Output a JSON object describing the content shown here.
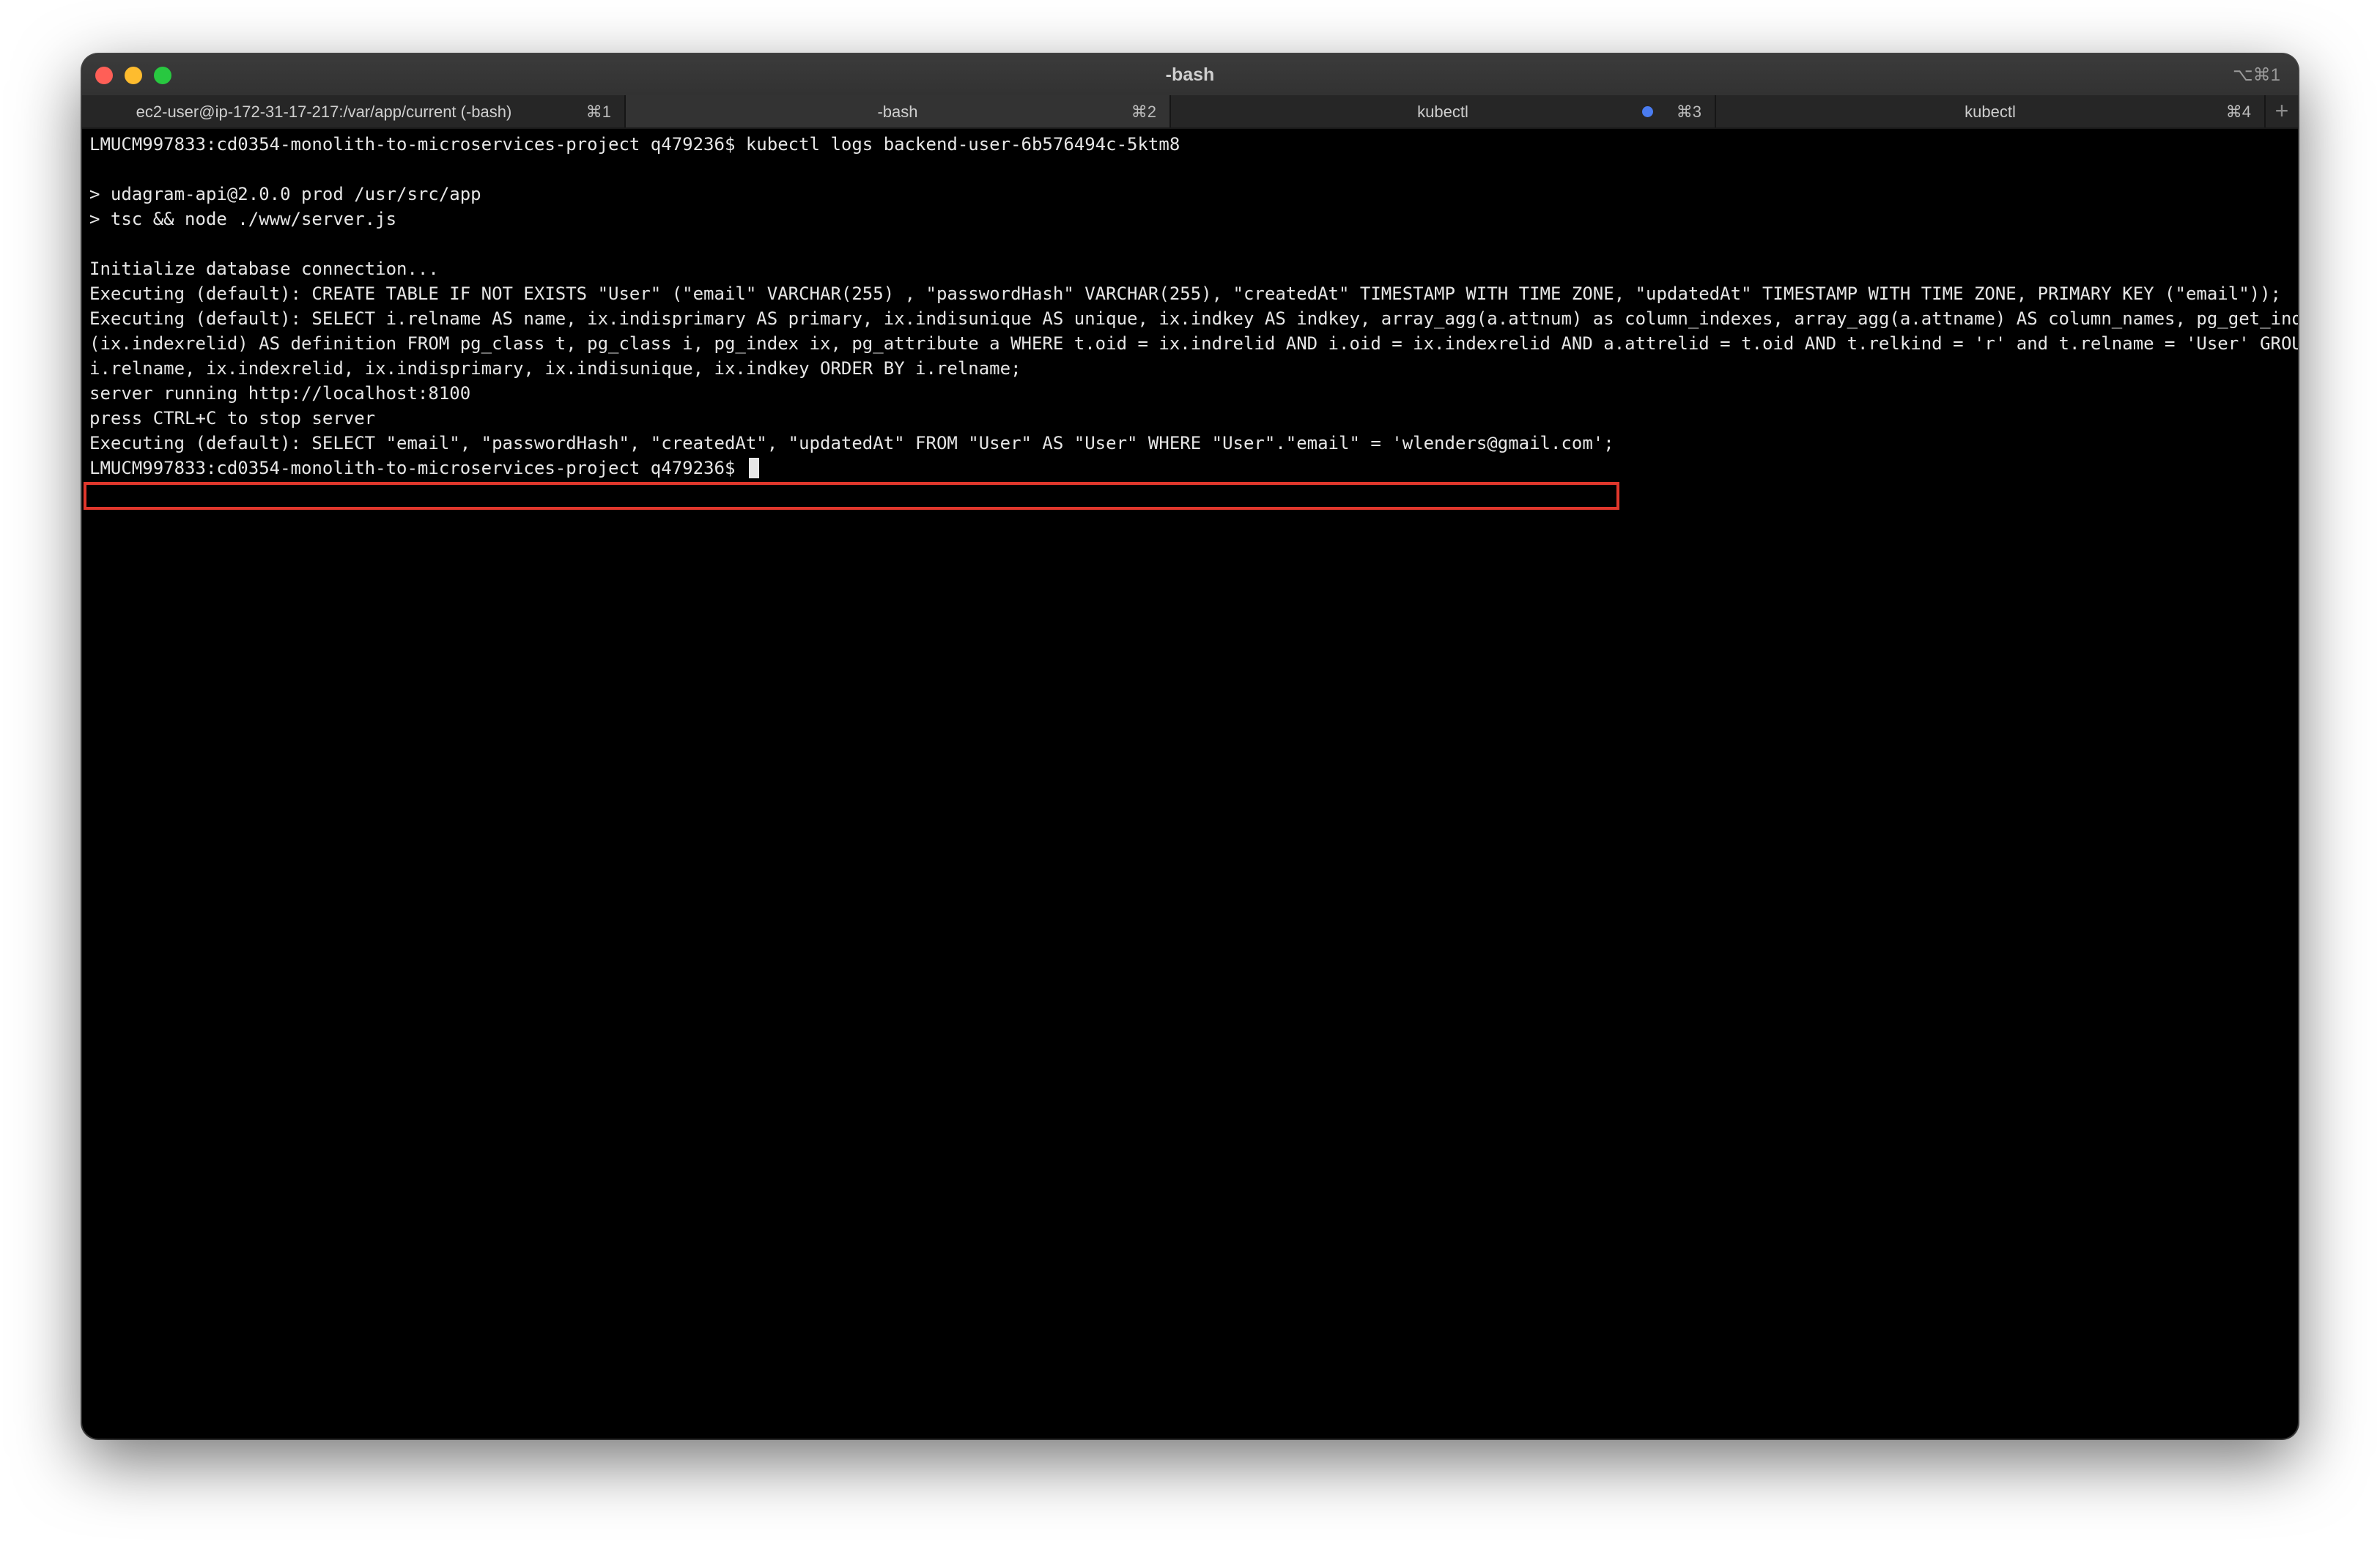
{
  "window": {
    "title": "-bash",
    "title_shortcut": "⌥⌘1"
  },
  "tabs": [
    {
      "label": "ec2-user@ip-172-31-17-217:/var/app/current (-bash)",
      "shortcut": "⌘1"
    },
    {
      "label": "-bash",
      "shortcut": "⌘2"
    },
    {
      "label": "kubectl",
      "shortcut": "⌘3"
    },
    {
      "label": "kubectl",
      "shortcut": "⌘4"
    }
  ],
  "new_tab_label": "+",
  "terminal": {
    "lines": [
      "LMUCM997833:cd0354-monolith-to-microservices-project q479236$ kubectl logs backend-user-6b576494c-5ktm8",
      "",
      "> udagram-api@2.0.0 prod /usr/src/app",
      "> tsc && node ./www/server.js",
      "",
      "Initialize database connection...",
      "Executing (default): CREATE TABLE IF NOT EXISTS \"User\" (\"email\" VARCHAR(255) , \"passwordHash\" VARCHAR(255), \"createdAt\" TIMESTAMP WITH TIME ZONE, \"updatedAt\" TIMESTAMP WITH TIME ZONE, PRIMARY KEY (\"email\"));",
      "Executing (default): SELECT i.relname AS name, ix.indisprimary AS primary, ix.indisunique AS unique, ix.indkey AS indkey, array_agg(a.attnum) as column_indexes, array_agg(a.attname) AS column_names, pg_get_indexdef",
      "(ix.indexrelid) AS definition FROM pg_class t, pg_class i, pg_index ix, pg_attribute a WHERE t.oid = ix.indrelid AND i.oid = ix.indexrelid AND a.attrelid = t.oid AND t.relkind = 'r' and t.relname = 'User' GROUP BY",
      "i.relname, ix.indexrelid, ix.indisprimary, ix.indisunique, ix.indkey ORDER BY i.relname;",
      "server running http://localhost:8100",
      "press CTRL+C to stop server",
      "Executing (default): SELECT \"email\", \"passwordHash\", \"createdAt\", \"updatedAt\" FROM \"User\" AS \"User\" WHERE \"User\".\"email\" = 'wlenders@gmail.com';"
    ],
    "prompt": "LMUCM997833:cd0354-monolith-to-microservices-project q479236$ "
  },
  "colors": {
    "highlight": "#e0372c",
    "activity_dot": "#4a7cf0"
  }
}
